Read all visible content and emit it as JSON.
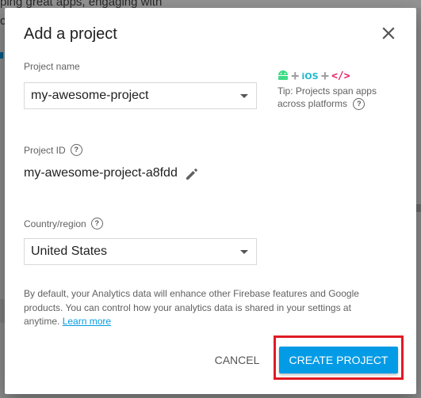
{
  "background": {
    "line1": "ping great apps, engaging with",
    "line2": "ch"
  },
  "dialog": {
    "title": "Add a project",
    "project_name": {
      "label": "Project name",
      "value": "my-awesome-project"
    },
    "tip": {
      "platform_ios": "iOS",
      "platform_web": "</>",
      "text": "Tip: Projects span apps across platforms"
    },
    "project_id": {
      "label": "Project ID",
      "value": "my-awesome-project-a8fdd"
    },
    "country": {
      "label": "Country/region",
      "value": "United States"
    },
    "info": {
      "text": "By default, your Analytics data will enhance other Firebase features and Google products. You can control how your analytics data is shared in your settings at anytime.",
      "link": "Learn more"
    },
    "buttons": {
      "cancel": "CANCEL",
      "create": "CREATE PROJECT"
    }
  },
  "colors": {
    "accent": "#039be5",
    "highlight": "#e01b24",
    "android": "#3ddc84",
    "ios": "#1fb8cd",
    "web": "#e91e63"
  },
  "icons": [
    "close-icon",
    "chevron-down-icon",
    "android-icon",
    "help-icon",
    "pencil-icon"
  ]
}
